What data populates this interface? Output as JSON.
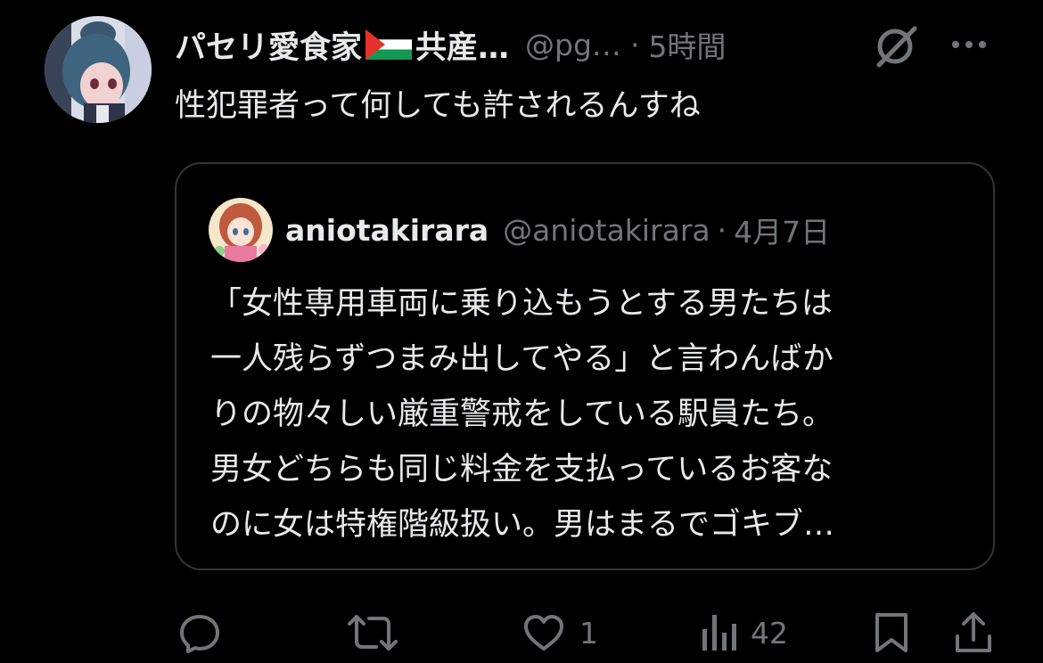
{
  "post": {
    "author_name": "パセリ愛食家",
    "author_name_suffix": "共産…",
    "author_handle": "@pg…",
    "separator": "·",
    "time": "5時間",
    "text": "性犯罪者って何しても許されるんすね",
    "icons": [
      "grok-icon",
      "more-icon",
      "palestine-flag-icon"
    ]
  },
  "quote": {
    "author_name": "aniotakirara",
    "author_handle": "@aniotakirara",
    "separator": "·",
    "date": "4月7日",
    "lines": [
      "「女性専用車両に乗り込もうとする男たちは",
      "一人残らずつまみ出してやる」と言わんばか",
      "りの物々しい厳重警戒をしている駅員たち。",
      "男女どちらも同じ料金を支払っているお客な",
      "のに女は特権階級扱い。男はまるでゴキブ…"
    ]
  },
  "actions": {
    "reply_icon": "reply-icon",
    "repost_icon": "repost-icon",
    "like_icon": "heart-icon",
    "like_count": "1",
    "views_icon": "views-icon",
    "views_count": "42",
    "bookmark_icon": "bookmark-icon",
    "share_icon": "share-icon"
  },
  "colors": {
    "background": "#000000",
    "primary_text": "#e7e9ea",
    "secondary_text": "#71767b",
    "border": "#333639"
  }
}
